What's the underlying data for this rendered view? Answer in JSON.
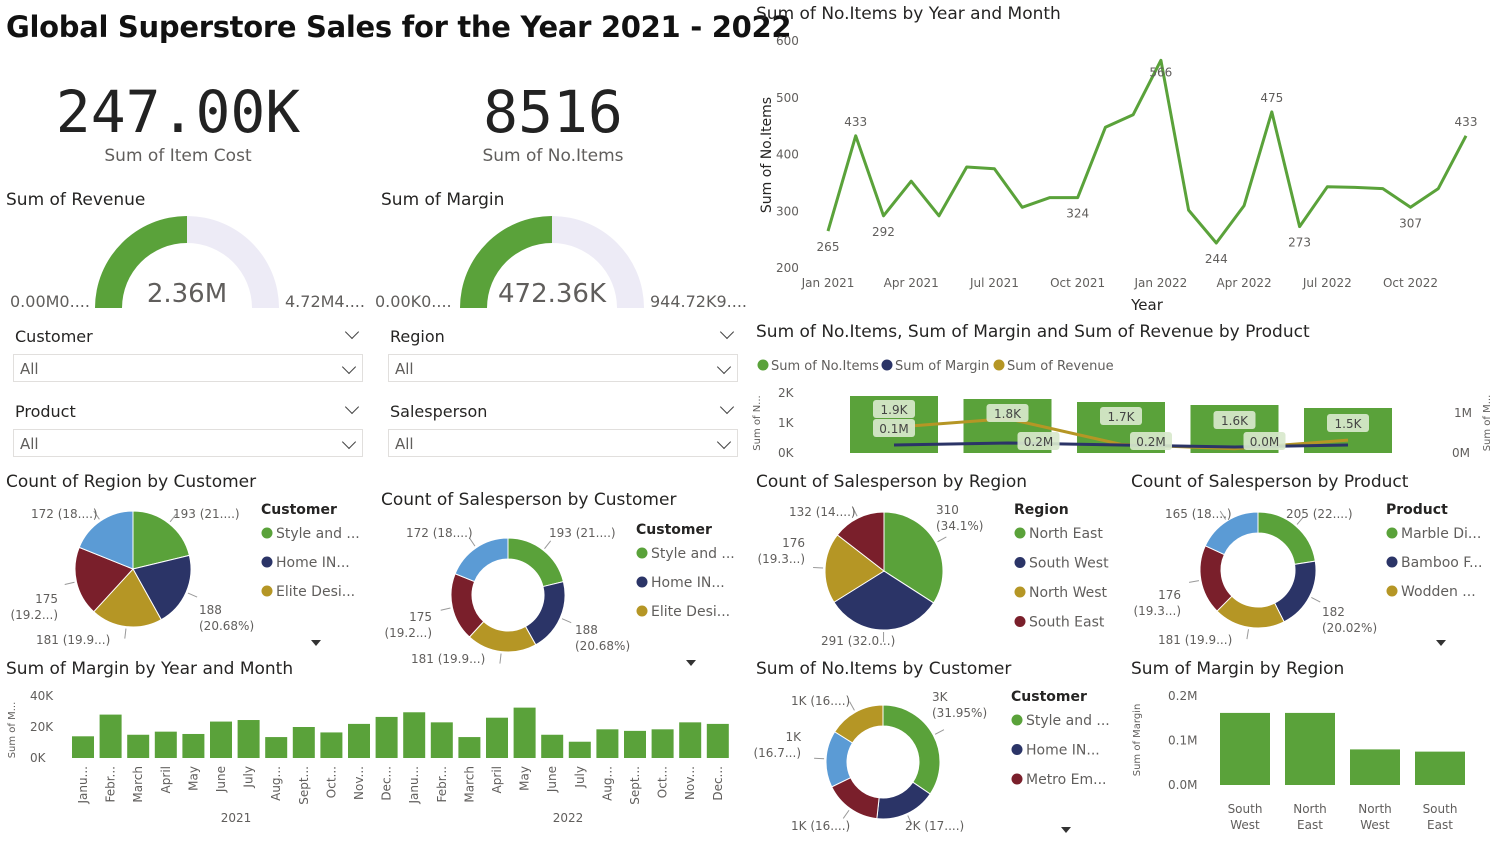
{
  "title": "Global Superstore Sales for the Year 2021 - 2022",
  "kpis": [
    {
      "value": "247.00K",
      "label": "Sum of Item Cost"
    },
    {
      "value": "8516",
      "label": "Sum of No.Items"
    }
  ],
  "gauges": [
    {
      "title": "Sum of Revenue",
      "value": "2.36M",
      "min": "0.00M0....",
      "max": "4.72M4....",
      "fraction": 0.5
    },
    {
      "title": "Sum of Margin",
      "value": "472.36K",
      "min": "0.00K0....",
      "max": "944.72K9....",
      "fraction": 0.5
    }
  ],
  "slicers": [
    {
      "label": "Customer",
      "value": "All"
    },
    {
      "label": "Region",
      "value": "All"
    },
    {
      "label": "Product",
      "value": "All"
    },
    {
      "label": "Salesperson",
      "value": "All"
    }
  ],
  "colors": {
    "green": "#5aa23a",
    "navy": "#2b3467",
    "gold": "#b59625",
    "red": "#7a1f2b",
    "blue": "#5b9bd5",
    "track": "#edebf6"
  },
  "chart_data": [
    {
      "id": "items_line",
      "type": "line",
      "title": "Sum of No.Items by Year and Month",
      "xlabel": "Year",
      "ylabel": "Sum of No.Items",
      "ylim": [
        200,
        600
      ],
      "yticks": [
        "600",
        "500",
        "400",
        "300",
        "200"
      ],
      "xticks": [
        "Jan 2021",
        "Apr 2021",
        "Jul 2021",
        "Oct 2021",
        "Jan 2022",
        "Apr 2022",
        "Jul 2022",
        "Oct 2022"
      ],
      "x": [
        "2021-01",
        "2021-02",
        "2021-03",
        "2021-04",
        "2021-05",
        "2021-06",
        "2021-07",
        "2021-08",
        "2021-09",
        "2021-10",
        "2021-11",
        "2021-12",
        "2022-01",
        "2022-02",
        "2022-03",
        "2022-04",
        "2022-05",
        "2022-06",
        "2022-07",
        "2022-08",
        "2022-09",
        "2022-10",
        "2022-11",
        "2022-12"
      ],
      "values": [
        265,
        433,
        292,
        353,
        292,
        378,
        375,
        307,
        324,
        324,
        448,
        470,
        566,
        302,
        244,
        310,
        475,
        273,
        343,
        342,
        340,
        307,
        340,
        433
      ],
      "labels": [
        {
          "i": 0,
          "text": "265",
          "pos": "below"
        },
        {
          "i": 1,
          "text": "433",
          "pos": "above"
        },
        {
          "i": 2,
          "text": "292",
          "pos": "below"
        },
        {
          "i": 9,
          "text": "324",
          "pos": "below"
        },
        {
          "i": 12,
          "text": "566",
          "pos": "on"
        },
        {
          "i": 14,
          "text": "244",
          "pos": "below"
        },
        {
          "i": 16,
          "text": "475",
          "pos": "above"
        },
        {
          "i": 17,
          "text": "273",
          "pos": "below"
        },
        {
          "i": 21,
          "text": "307",
          "pos": "below"
        },
        {
          "i": 23,
          "text": "433",
          "pos": "above"
        }
      ]
    },
    {
      "id": "product_combo",
      "type": "bar",
      "title": "Sum of No.Items, Sum of Margin and Sum of Revenue by Product",
      "ylabel": "Sum of N...",
      "y2label": "Sum of M...",
      "yticks": [
        "2K",
        "1K",
        "0K"
      ],
      "y2ticks": [
        "1M",
        "0M"
      ],
      "series": [
        {
          "name": "Sum of No.Items",
          "values": [
            1900,
            1800,
            1700,
            1600,
            1500
          ],
          "labels": [
            "1.9K",
            "1.8K",
            "1.7K",
            "1.6K",
            "1.5K"
          ]
        },
        {
          "name": "Sum of Margin",
          "values": [
            0.1,
            0.2,
            0.1,
            0.0,
            0.1
          ],
          "labels": [
            "0.1M",
            "0.2M",
            "0.2M",
            "0.0M",
            ""
          ]
        },
        {
          "name": "Sum of Revenue",
          "values": [
            0.6,
            0.8,
            0.2,
            0.1,
            0.3
          ],
          "labels": []
        }
      ]
    },
    {
      "id": "region_by_customer",
      "type": "pie",
      "title": "Count of Region by Customer",
      "legend_title": "Customer",
      "legend": [
        "Style and ...",
        "Home IN...",
        "Elite Desi..."
      ],
      "values": [
        193,
        188,
        181,
        175,
        172
      ],
      "labels": [
        "193 (21....)",
        "188\n(20.68%)",
        "181 (19.9...)",
        "175\n(19.2...)",
        "172 (18....)"
      ]
    },
    {
      "id": "sp_by_customer",
      "type": "pie",
      "title": "Count of Salesperson by Customer",
      "legend_title": "Customer",
      "legend": [
        "Style and ...",
        "Home IN...",
        "Elite Desi..."
      ],
      "values": [
        193,
        188,
        181,
        175,
        172
      ],
      "labels": [
        "193 (21....)",
        "188\n(20.68%)",
        "181 (19.9...)",
        "175\n(19.2...)",
        "172 (18....)"
      ]
    },
    {
      "id": "sp_by_region",
      "type": "pie",
      "title": "Count of Salesperson by Region",
      "legend_title": "Region",
      "legend": [
        "North East",
        "South West",
        "North West",
        "South East"
      ],
      "values": [
        310,
        291,
        176,
        132
      ],
      "labels": [
        "310\n(34.1%)",
        "291 (32.0...)",
        "176\n(19.3...)",
        "132 (14....)"
      ]
    },
    {
      "id": "sp_by_product",
      "type": "pie",
      "title": "Count of Salesperson by Product",
      "legend_title": "Product",
      "legend": [
        "Marble Di...",
        "Bamboo F...",
        "Wodden ..."
      ],
      "values": [
        205,
        182,
        181,
        176,
        165
      ],
      "labels": [
        "205 (22....)",
        "182\n(20.02%)",
        "181 (19.9...)",
        "176\n(19.3...)",
        "165 (18....)"
      ]
    },
    {
      "id": "margin_month",
      "type": "bar",
      "title": "Sum of Margin by Year and Month",
      "ylabel": "Sum of M...",
      "ylim": [
        0,
        40000
      ],
      "yticks": [
        "40K",
        "20K",
        "0K"
      ],
      "categories": [
        "Janu...",
        "Febr...",
        "March",
        "April",
        "May",
        "June",
        "July",
        "Aug...",
        "Sept...",
        "Oct...",
        "Nov...",
        "Dec...",
        "Janu...",
        "Febr...",
        "March",
        "April",
        "May",
        "June",
        "July",
        "Aug...",
        "Sept...",
        "Oct...",
        "Nov...",
        "Dec..."
      ],
      "years": [
        "2021",
        "2022"
      ],
      "values": [
        14000,
        28000,
        15000,
        17000,
        15500,
        23500,
        24500,
        13500,
        20000,
        16500,
        22000,
        26500,
        29500,
        23000,
        13500,
        26000,
        32500,
        15000,
        10500,
        18500,
        17500,
        18500,
        23000,
        22000
      ]
    },
    {
      "id": "items_by_customer",
      "type": "pie",
      "title": "Sum of No.Items by Customer",
      "legend_title": "Customer",
      "legend": [
        "Style and ...",
        "Home IN...",
        "Metro Em..."
      ],
      "values": [
        3000,
        1500,
        1400,
        1400,
        1400
      ],
      "labels": [
        "3K\n(31.95%)",
        "2K (17....)",
        "1K (16....)",
        "1K\n(16.7...)",
        "1K (16....)"
      ]
    },
    {
      "id": "margin_by_region",
      "type": "bar",
      "title": "Sum of Margin by Region",
      "ylabel": "Sum of Margin",
      "ylim": [
        0,
        0.2
      ],
      "yticks": [
        "0.2M",
        "0.1M",
        "0.0M"
      ],
      "categories": [
        "South\nWest",
        "North\nEast",
        "North\nWest",
        "South\nEast"
      ],
      "values": [
        0.162,
        0.162,
        0.08,
        0.075
      ]
    }
  ]
}
